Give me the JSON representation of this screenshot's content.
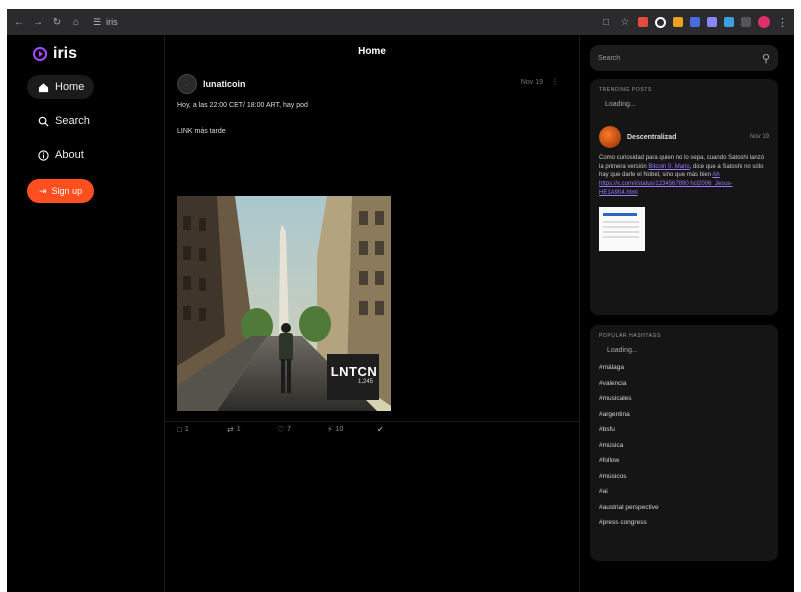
{
  "browser": {
    "tab_label": "iris",
    "colors": {
      "frame": "#2b2b2e"
    }
  },
  "app": {
    "logo_text": "iris",
    "colors": {
      "accent": "#a34bff",
      "signup": "#ff4f1f",
      "link": "#9a7bff"
    }
  },
  "sidebar": {
    "items": [
      {
        "label": "Home",
        "icon": "home-icon"
      },
      {
        "label": "Search",
        "icon": "search-icon"
      },
      {
        "label": "About",
        "icon": "info-icon"
      }
    ],
    "signup_label": "Sign up"
  },
  "main": {
    "header_title": "Home",
    "post": {
      "author": "lunaticoin",
      "date": "Nov 19",
      "text_line1": "Hoy, a las 22:00 CET/ 18:00 ART, hay pod",
      "text_line2": "LINK más tarde",
      "image_caption_title": "LNTCN",
      "image_caption_sub": "1,245",
      "actions": {
        "replies": "1",
        "reposts": "1",
        "likes": "7",
        "zaps": "10"
      }
    }
  },
  "right": {
    "search": {
      "placeholder": "Search"
    },
    "trending": {
      "title": "TRENDING POSTS",
      "loading": "Loading...",
      "post": {
        "author": "Descentralizad",
        "date": "Nov 19",
        "text": "Como curiosidad para quien no lo sepa, cuando Satoshi lanzó la primera versión ",
        "link1": "Bitcoin 0. Mario",
        "text_mid": ", dice que a Satoshi no sólo hay que darle el Nobel, sino que más bien ",
        "link2": "Ah https://x.com/i/status/1234567890 hcl2006_Jesus-HE1A904.html"
      }
    },
    "hashtags": {
      "title": "POPULAR HASHTAGS",
      "loading": "Loading...",
      "items": [
        "#málaga",
        "#valencia",
        "#musicales",
        "#argentina",
        "#bsfu",
        "#música",
        "#follow",
        "#músicos",
        "#ai",
        "#austrial perspective",
        "#press congress"
      ]
    }
  }
}
